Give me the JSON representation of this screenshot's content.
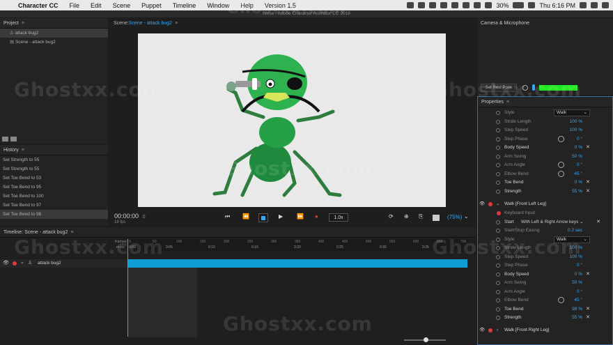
{
  "menubar": {
    "app": "Character CC",
    "items": [
      "File",
      "Edit",
      "Scene",
      "Puppet",
      "Timeline",
      "Window",
      "Help",
      "Version 1.5"
    ],
    "battery": "30%",
    "clock": "Thu 6:16 PM"
  },
  "window_title": "horse - Adobe Character Animator CC 2018",
  "project": {
    "title": "Project",
    "items": [
      "attack bug2",
      "Scene - attack bug2"
    ]
  },
  "scene": {
    "prefix": "Scene:",
    "name": "Scene - attack bug2"
  },
  "camera": {
    "title": "Camera & Microphone",
    "rest_pose": "Set Rest Pose"
  },
  "history": {
    "title": "History",
    "items": [
      "Set Strength to 55",
      "Set Strength to 55",
      "Set Toe Bend to 53",
      "Set Toe Bend to 95",
      "Set Toe Bend to 100",
      "Set Toe Bend to 97",
      "Set Toe Bend to 98"
    ]
  },
  "controls": {
    "timecode": "00:00:00",
    "frame": "0",
    "fps": "18 fps",
    "speed": "1.0x",
    "zoom": "(75%)"
  },
  "timeline": {
    "title": "Timeline: Scene - attack bug2",
    "frames_label": "frames",
    "time_label": "m:ss",
    "ruler_top": [
      "0",
      "50",
      "100",
      "150",
      "200",
      "250",
      "300",
      "350",
      "400",
      "450",
      "500",
      "550",
      "600",
      "650",
      "700"
    ],
    "ruler_bottom": [
      "0:00",
      "0:05",
      "0:10",
      "0:15",
      "0:20",
      "0:25",
      "0:30",
      "0:35"
    ],
    "track": "attack bug2"
  },
  "properties": {
    "title": "Properties",
    "group1": [
      {
        "label": "Style",
        "dropdown": "Walk"
      },
      {
        "label": "Stride Length",
        "value": "100 %"
      },
      {
        "label": "Step Speed",
        "value": "100 %"
      },
      {
        "label": "Step Phase",
        "value": "0 °"
      },
      {
        "label": "Body Speed",
        "value": "0 %"
      },
      {
        "label": "Arm Swing",
        "value": "50 %"
      },
      {
        "label": "Arm Angle",
        "value": "0 °"
      },
      {
        "label": "Elbow Bend",
        "value": "45 °"
      },
      {
        "label": "Toe Bend",
        "value": "0 %"
      },
      {
        "label": "Strength",
        "value": "55 %"
      }
    ],
    "walk_front_left": "Walk [Front Left Leg]",
    "keyboard_input": "Keyboard Input",
    "start_label": "Start",
    "start_value": "With Left & Right Arrow keys",
    "start_stop_easing": "Start/Stop Easing",
    "easing_value": "0.2 sec",
    "group2": [
      {
        "label": "Style",
        "dropdown": "Walk"
      },
      {
        "label": "Stride Length",
        "value": "100 %"
      },
      {
        "label": "Step Speed",
        "value": "100 %"
      },
      {
        "label": "Step Phase",
        "value": "0 °"
      },
      {
        "label": "Body Speed",
        "value": "0 %"
      },
      {
        "label": "Arm Swing",
        "value": "50 %"
      },
      {
        "label": "Arm Angle",
        "value": "0 °"
      },
      {
        "label": "Elbow Bend",
        "value": "45 °"
      },
      {
        "label": "Toe Bend",
        "value": "98 %"
      },
      {
        "label": "Strength",
        "value": "55 %"
      }
    ],
    "walk_front_right": "Walk [Front Right Leg]"
  },
  "watermark": "Ghostxx.com",
  "colors": {
    "accent": "#36a8f5",
    "record": "#e03a3a",
    "track": "#0d9ed6",
    "meter": "#1ee81e"
  }
}
